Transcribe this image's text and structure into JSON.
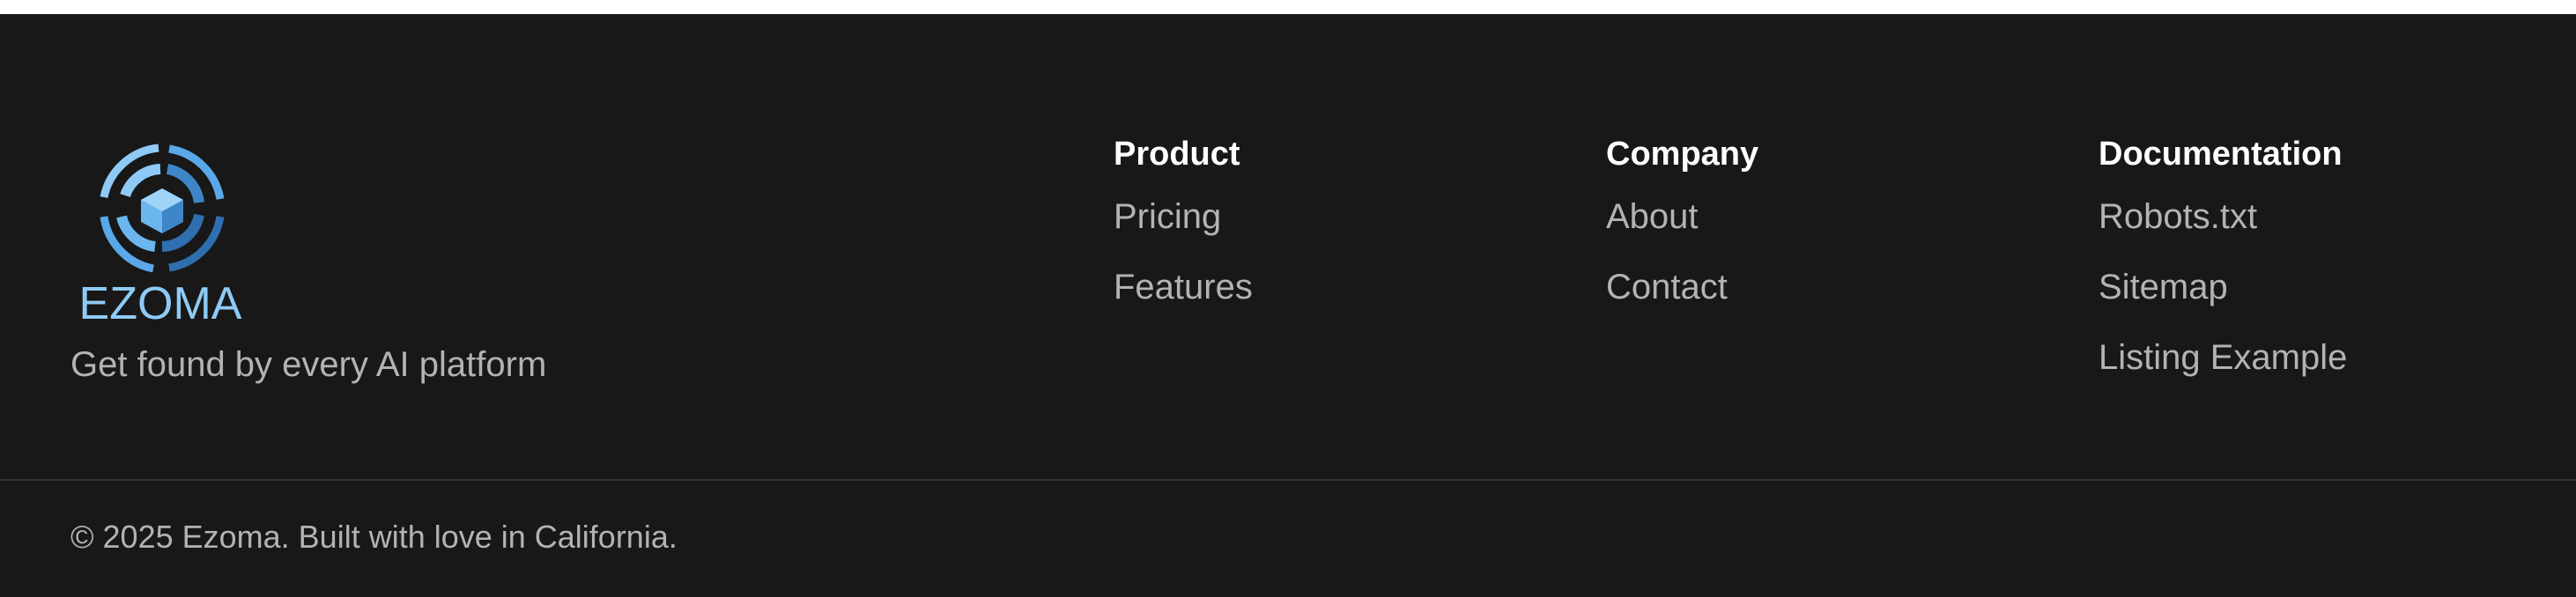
{
  "brand": {
    "logo_icon": "ezoma-hex-logo-icon",
    "logo_text": "EZOMA",
    "tagline": "Get found by every AI platform",
    "colors": {
      "light_blue": "#8fcaf6",
      "mid_blue": "#5aa8e8",
      "dark_blue": "#2f6fb0"
    }
  },
  "columns": [
    {
      "heading": "Product",
      "links": [
        "Pricing",
        "Features"
      ]
    },
    {
      "heading": "Company",
      "links": [
        "About",
        "Contact"
      ]
    },
    {
      "heading": "Documentation",
      "links": [
        "Robots.txt",
        "Sitemap",
        "Listing Example"
      ]
    }
  ],
  "copyright": "© 2025 Ezoma. Built with love in California.",
  "theme": {
    "background": "#181818",
    "heading_color": "#ffffff",
    "link_color": "#b3b3b3",
    "divider_color": "#323232"
  }
}
